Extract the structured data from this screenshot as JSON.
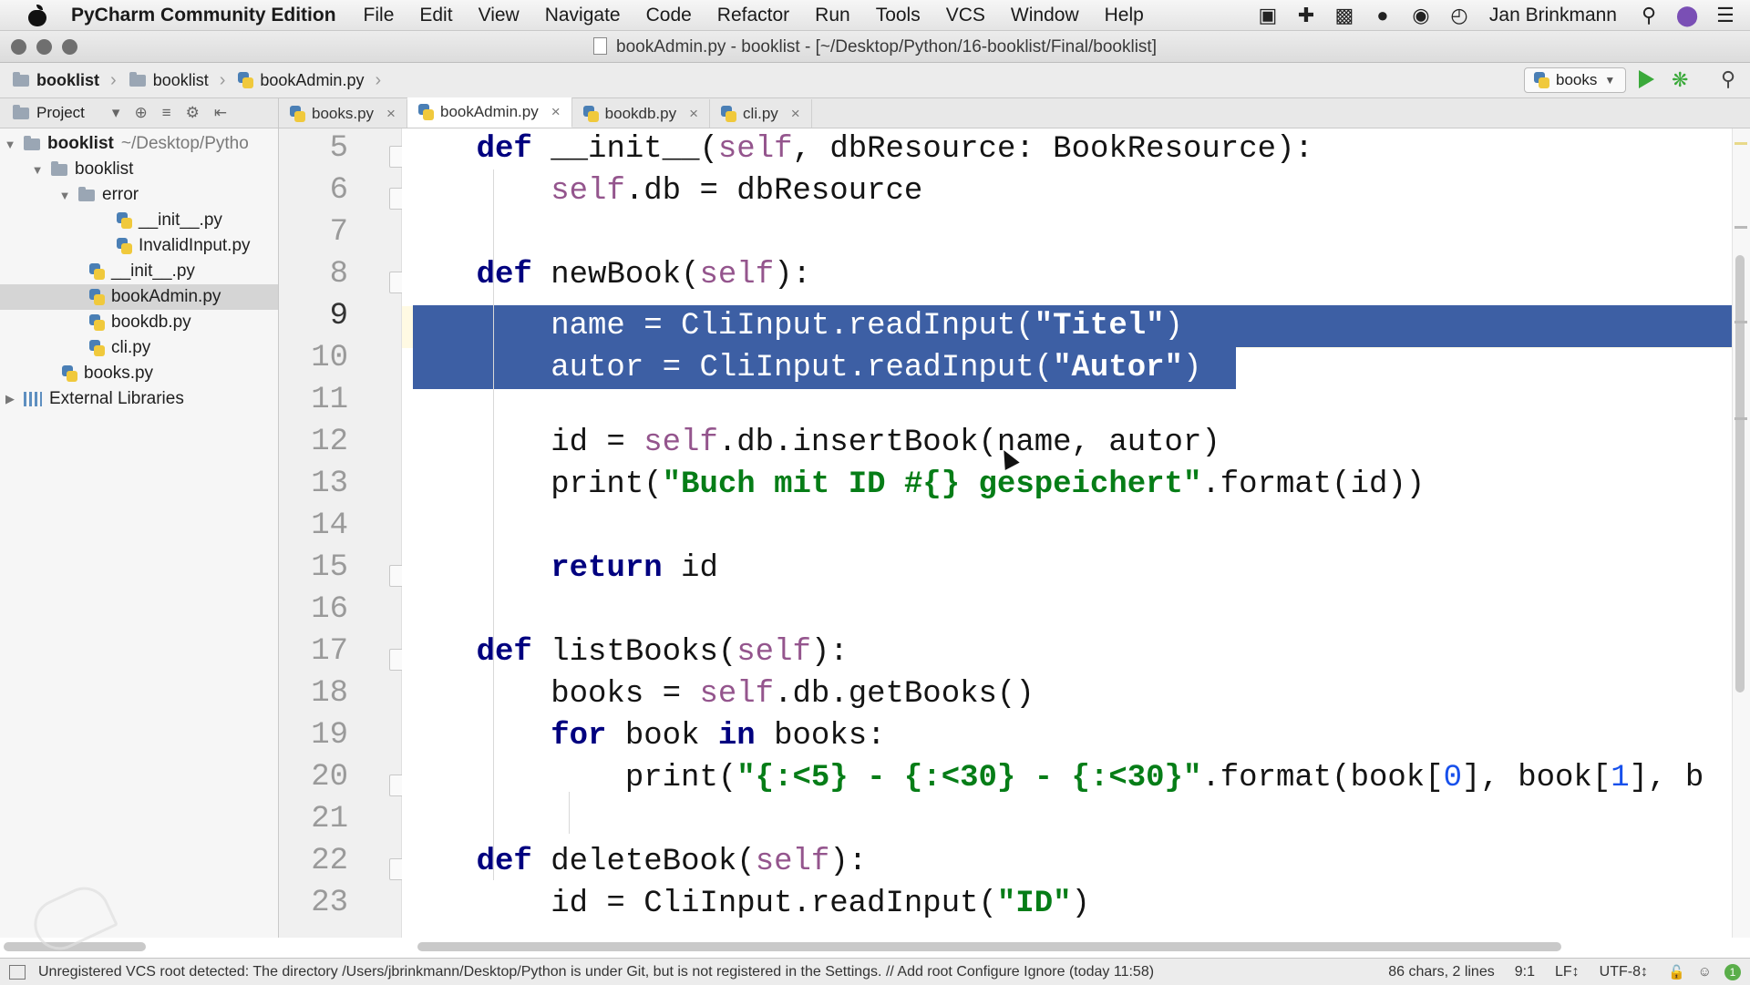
{
  "menubar": {
    "app_name": "PyCharm Community Edition",
    "items": [
      "File",
      "Edit",
      "View",
      "Navigate",
      "Code",
      "Refactor",
      "Run",
      "Tools",
      "VCS",
      "Window",
      "Help"
    ],
    "user": "Jan Brinkmann",
    "tray_icons": [
      "bag-icon",
      "plus-cross-icon",
      "video-icon",
      "leaf-icon",
      "chat-icon",
      "clock-icon",
      "spotlight-search-icon",
      "siri-icon",
      "list-icon"
    ]
  },
  "window": {
    "title": "bookAdmin.py - booklist - [~/Desktop/Python/16-booklist/Final/booklist]"
  },
  "breadcrumbs": [
    "booklist",
    "booklist",
    "bookAdmin.py"
  ],
  "run_config": {
    "label": "books"
  },
  "project_panel": {
    "label": "Project"
  },
  "tabs": [
    {
      "label": "books.py",
      "active": false
    },
    {
      "label": "bookAdmin.py",
      "active": true
    },
    {
      "label": "bookdb.py",
      "active": false
    },
    {
      "label": "cli.py",
      "active": false
    }
  ],
  "tree": [
    {
      "label": "booklist",
      "extra": "~/Desktop/Pytho",
      "kind": "folder",
      "arrow": "▼",
      "bold": true
    },
    {
      "label": "booklist",
      "kind": "folder",
      "arrow": "▼"
    },
    {
      "label": "error",
      "kind": "folder",
      "arrow": "▼"
    },
    {
      "label": "__init__.py",
      "kind": "py"
    },
    {
      "label": "InvalidInput.py",
      "kind": "py"
    },
    {
      "label": "__init__.py",
      "kind": "py"
    },
    {
      "label": "bookAdmin.py",
      "kind": "py",
      "selected": true
    },
    {
      "label": "bookdb.py",
      "kind": "py"
    },
    {
      "label": "cli.py",
      "kind": "py"
    },
    {
      "label": "books.py",
      "kind": "py"
    },
    {
      "label": "External Libraries",
      "kind": "lib",
      "arrow": "▶"
    }
  ],
  "editor": {
    "current_line": 9,
    "selection": "lines 9–10",
    "lines": [
      {
        "no": "5",
        "text": "    def __init__(self, dbResource: BookResource):"
      },
      {
        "no": "6",
        "text": "        self.db = dbResource"
      },
      {
        "no": "7",
        "text": ""
      },
      {
        "no": "8",
        "text": "    def newBook(self):"
      },
      {
        "no": "9",
        "text": "        name = CliInput.readInput(\"Titel\")"
      },
      {
        "no": "10",
        "text": "        autor = CliInput.readInput(\"Autor\")"
      },
      {
        "no": "11",
        "text": ""
      },
      {
        "no": "12",
        "text": "        id = self.db.insertBook(name, autor)"
      },
      {
        "no": "13",
        "text": "        print(\"Buch mit ID #{} gespeichert\".format(id))"
      },
      {
        "no": "14",
        "text": ""
      },
      {
        "no": "15",
        "text": "        return id"
      },
      {
        "no": "16",
        "text": ""
      },
      {
        "no": "17",
        "text": "    def listBooks(self):"
      },
      {
        "no": "18",
        "text": "        books = self.db.getBooks()"
      },
      {
        "no": "19",
        "text": "        for book in books:"
      },
      {
        "no": "20",
        "text": "            print(\"{:<5} - {:<30} - {:<30}\".format(book[0], book[1], b"
      },
      {
        "no": "21",
        "text": ""
      },
      {
        "no": "22",
        "text": "    def deleteBook(self):"
      },
      {
        "no": "23",
        "text": "        id = CliInput.readInput(\"ID\")"
      }
    ]
  },
  "status": {
    "message": "Unregistered VCS root detected: The directory /Users/jbrinkmann/Desktop/Python is under Git, but is not registered in the Settings. // Add root   Configure   Ignore (today 11:58)",
    "chars": "86 chars, 2 lines",
    "position": "9:1",
    "line_sep": "LF↕",
    "encoding": "UTF-8↕",
    "events": "1"
  }
}
